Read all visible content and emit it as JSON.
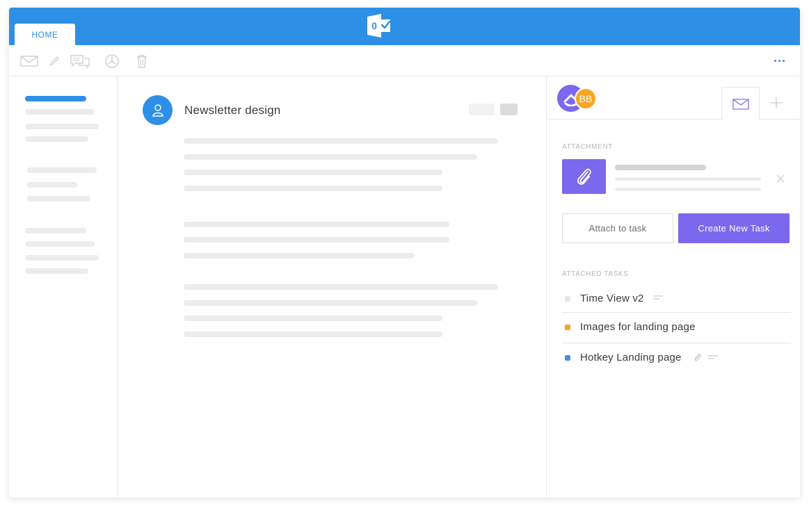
{
  "header": {
    "tab_home": "HOME",
    "app_logo_letter": "0"
  },
  "toolbar": {
    "icons": [
      "mail-icon",
      "pencil-icon",
      "chat-icon",
      "pie-chart-icon",
      "trash-icon",
      "more-icon"
    ]
  },
  "email": {
    "subject": "Newsletter design"
  },
  "panel": {
    "user_initials": "BB",
    "attachment_label": "ATTACHMENT",
    "attach_button": "Attach to task",
    "create_button": "Create New Task",
    "attached_tasks_label": "ATTACHED TASKS",
    "tasks": [
      {
        "name": "Time View v2",
        "status_color": "#e6e6e6"
      },
      {
        "name": "Images for landing page",
        "status_color": "#f5a623"
      },
      {
        "name": "Hotkey Landing page",
        "status_color": "#4a90e2"
      }
    ]
  },
  "colors": {
    "brand_blue": "#2e8fe6",
    "accent_purple": "#7b68ee",
    "avatar_orange": "#f5a623"
  }
}
